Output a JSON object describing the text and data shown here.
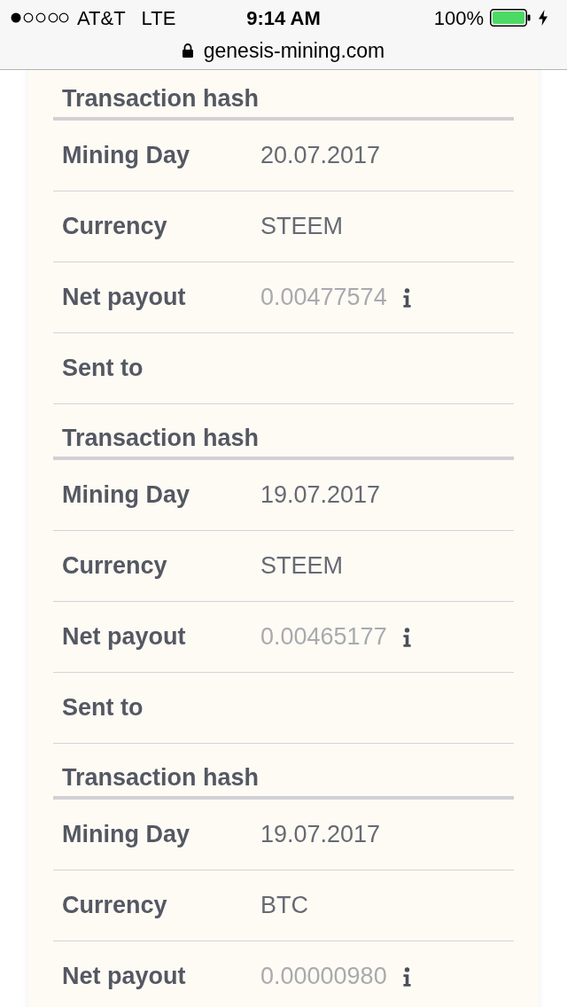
{
  "status_bar": {
    "carrier": "AT&T",
    "network": "LTE",
    "time": "9:14 AM",
    "battery": "100%",
    "charging": true
  },
  "address_bar": {
    "url": "genesis-mining.com",
    "secure": true
  },
  "entries": [
    {
      "rows": [
        {
          "kind": "hash",
          "label": "Transaction hash"
        }
      ]
    },
    {
      "rows": [
        {
          "kind": "plain",
          "label": "Mining Day",
          "value": "20.07.2017"
        },
        {
          "kind": "plain",
          "label": "Currency",
          "value": "STEEM"
        },
        {
          "kind": "payout",
          "label": "Net payout",
          "value": "0.00477574"
        },
        {
          "kind": "plain",
          "label": "Sent to"
        },
        {
          "kind": "hash",
          "label": "Transaction hash"
        }
      ]
    },
    {
      "rows": [
        {
          "kind": "plain",
          "label": "Mining Day",
          "value": "19.07.2017"
        },
        {
          "kind": "plain",
          "label": "Currency",
          "value": "STEEM"
        },
        {
          "kind": "payout",
          "label": "Net payout",
          "value": "0.00465177"
        },
        {
          "kind": "plain",
          "label": "Sent to"
        },
        {
          "kind": "hash",
          "label": "Transaction hash"
        }
      ]
    },
    {
      "rows": [
        {
          "kind": "plain",
          "label": "Mining Day",
          "value": "19.07.2017"
        },
        {
          "kind": "plain",
          "label": "Currency",
          "value": "BTC"
        },
        {
          "kind": "payout",
          "label": "Net payout",
          "value": "0.00000980"
        }
      ]
    }
  ]
}
